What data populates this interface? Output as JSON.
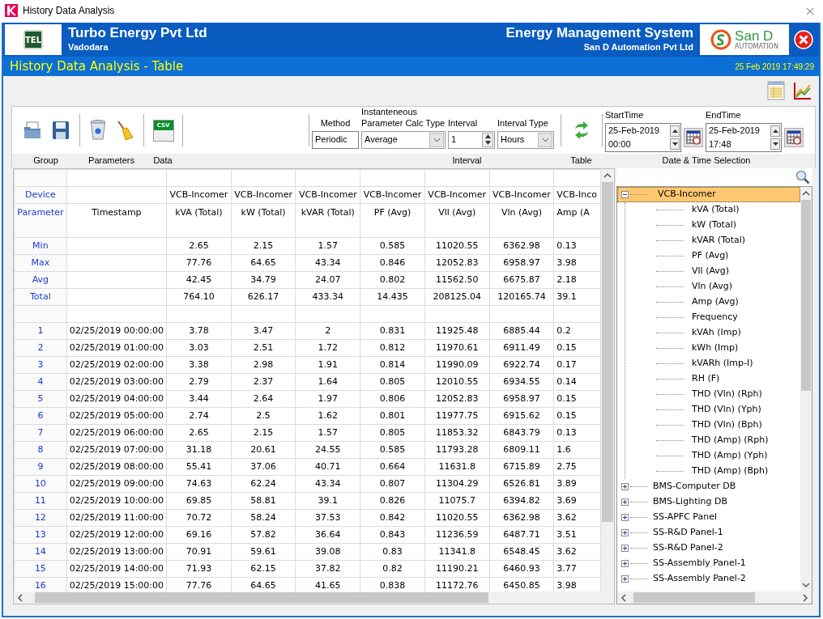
{
  "window": {
    "title": "History Data Analysis"
  },
  "header": {
    "logo_text": "TEL",
    "company": "Turbo Energy Pvt Ltd",
    "city": "Vadodara",
    "system": "Energy Management System",
    "vendor": "San D Automation Pvt Ltd",
    "vendor_logo": {
      "name": "San D",
      "tagline": "AUTOMATION"
    },
    "subtitle": "History Data Analysis - Table",
    "datetime": "25 Feb 2019 17:49:29"
  },
  "toolbar": {
    "group_label": "Group",
    "parameters_label": "Parameters",
    "data_label": "Data",
    "csv_text": "CSV",
    "interval_label": "Interval",
    "table_label": "Table",
    "datetime_label": "Date & Time Selection",
    "method": {
      "label": "Method",
      "value": "Periodic"
    },
    "calc_type": {
      "label_lines": [
        "Instanteneous",
        "Parameter Calc Type"
      ],
      "value": "Average"
    },
    "interval": {
      "label": "Interval",
      "value": "1"
    },
    "interval_type": {
      "label": "Interval Type",
      "value": "Hours"
    },
    "start": {
      "label": "StartTime",
      "date": "25-Feb-2019",
      "time": "00:00"
    },
    "end": {
      "label": "EndTime",
      "date": "25-Feb-2019",
      "time": "17:48"
    }
  },
  "table": {
    "device_label": "Device",
    "parameter_label": "Parameter",
    "timestamp_label": "Timestamp",
    "columns": [
      {
        "device": "VCB-Incomer",
        "parameter": "kVA (Total)"
      },
      {
        "device": "VCB-Incomer",
        "parameter": "kW (Total)"
      },
      {
        "device": "VCB-Incomer",
        "parameter": "kVAR (Total)"
      },
      {
        "device": "VCB-Incomer",
        "parameter": "PF (Avg)"
      },
      {
        "device": "VCB-Incomer",
        "parameter": "Vll (Avg)"
      },
      {
        "device": "VCB-Incomer",
        "parameter": "Vln (Avg)"
      },
      {
        "device": "VCB-Inco",
        "parameter": "Amp (A"
      }
    ],
    "summary": [
      {
        "label": "Min",
        "values": [
          "2.65",
          "2.15",
          "1.57",
          "0.585",
          "11020.55",
          "6362.98",
          "0.13"
        ]
      },
      {
        "label": "Max",
        "values": [
          "77.76",
          "64.65",
          "43.34",
          "0.846",
          "12052.83",
          "6958.97",
          "3.98"
        ]
      },
      {
        "label": "Avg",
        "values": [
          "42.45",
          "34.79",
          "24.07",
          "0.802",
          "11562.50",
          "6675.87",
          "2.18"
        ]
      },
      {
        "label": "Total",
        "values": [
          "764.10",
          "626.17",
          "433.34",
          "14.435",
          "208125.04",
          "120165.74",
          "39.1"
        ]
      }
    ],
    "rows": [
      {
        "index": "1",
        "timestamp": "02/25/2019 00:00:00",
        "values": [
          "3.78",
          "3.47",
          "2",
          "0.831",
          "11925.48",
          "6885.44",
          "0.2"
        ]
      },
      {
        "index": "2",
        "timestamp": "02/25/2019 01:00:00",
        "values": [
          "3.03",
          "2.51",
          "1.72",
          "0.812",
          "11970.61",
          "6911.49",
          "0.15"
        ]
      },
      {
        "index": "3",
        "timestamp": "02/25/2019 02:00:00",
        "values": [
          "3.38",
          "2.98",
          "1.91",
          "0.814",
          "11990.09",
          "6922.74",
          "0.17"
        ]
      },
      {
        "index": "4",
        "timestamp": "02/25/2019 03:00:00",
        "values": [
          "2.79",
          "2.37",
          "1.64",
          "0.805",
          "12010.55",
          "6934.55",
          "0.14"
        ]
      },
      {
        "index": "5",
        "timestamp": "02/25/2019 04:00:00",
        "values": [
          "3.44",
          "2.64",
          "1.97",
          "0.806",
          "12052.83",
          "6958.97",
          "0.15"
        ]
      },
      {
        "index": "6",
        "timestamp": "02/25/2019 05:00:00",
        "values": [
          "2.74",
          "2.5",
          "1.62",
          "0.801",
          "11977.75",
          "6915.62",
          "0.15"
        ]
      },
      {
        "index": "7",
        "timestamp": "02/25/2019 06:00:00",
        "values": [
          "2.65",
          "2.15",
          "1.57",
          "0.805",
          "11853.32",
          "6843.79",
          "0.13"
        ]
      },
      {
        "index": "8",
        "timestamp": "02/25/2019 07:00:00",
        "values": [
          "31.18",
          "20.61",
          "24.55",
          "0.585",
          "11793.28",
          "6809.11",
          "1.6"
        ]
      },
      {
        "index": "9",
        "timestamp": "02/25/2019 08:00:00",
        "values": [
          "55.41",
          "37.06",
          "40.71",
          "0.664",
          "11631.8",
          "6715.89",
          "2.75"
        ]
      },
      {
        "index": "10",
        "timestamp": "02/25/2019 09:00:00",
        "values": [
          "74.63",
          "62.24",
          "43.34",
          "0.807",
          "11304.29",
          "6526.81",
          "3.89"
        ]
      },
      {
        "index": "11",
        "timestamp": "02/25/2019 10:00:00",
        "values": [
          "69.85",
          "58.81",
          "39.1",
          "0.826",
          "11075.7",
          "6394.82",
          "3.69"
        ]
      },
      {
        "index": "12",
        "timestamp": "02/25/2019 11:00:00",
        "values": [
          "70.72",
          "58.24",
          "37.53",
          "0.842",
          "11020.55",
          "6362.98",
          "3.62"
        ]
      },
      {
        "index": "13",
        "timestamp": "02/25/2019 12:00:00",
        "values": [
          "69.16",
          "57.82",
          "36.64",
          "0.843",
          "11236.59",
          "6487.71",
          "3.51"
        ]
      },
      {
        "index": "14",
        "timestamp": "02/25/2019 13:00:00",
        "values": [
          "70.91",
          "59.61",
          "39.08",
          "0.83",
          "11341.8",
          "6548.45",
          "3.62"
        ]
      },
      {
        "index": "15",
        "timestamp": "02/25/2019 14:00:00",
        "values": [
          "71.93",
          "62.15",
          "37.82",
          "0.82",
          "11190.21",
          "6460.93",
          "3.77"
        ]
      },
      {
        "index": "16",
        "timestamp": "02/25/2019 15:00:00",
        "values": [
          "77.76",
          "64.65",
          "41.65",
          "0.838",
          "11172.76",
          "6450.85",
          "3.98"
        ]
      }
    ]
  },
  "tree": {
    "items": [
      {
        "label": "VCB-Incomer",
        "expanded": true,
        "selected": true,
        "children": [
          {
            "label": "kVA (Total)"
          },
          {
            "label": "kW (Total)"
          },
          {
            "label": "kVAR (Total)"
          },
          {
            "label": "PF (Avg)"
          },
          {
            "label": "Vll (Avg)"
          },
          {
            "label": "Vln (Avg)"
          },
          {
            "label": "Amp (Avg)"
          },
          {
            "label": "Frequency"
          },
          {
            "label": "kVAh (Imp)"
          },
          {
            "label": "kWh (Imp)"
          },
          {
            "label": "kVARh (Imp-I)"
          },
          {
            "label": "RH (F)"
          },
          {
            "label": "THD (Vln) (Rph)"
          },
          {
            "label": "THD (Vln) (Yph)"
          },
          {
            "label": "THD (Vln) (Bph)"
          },
          {
            "label": "THD (Amp) (Rph)"
          },
          {
            "label": "THD (Amp) (Yph)"
          },
          {
            "label": "THD (Amp) (Bph)"
          }
        ]
      },
      {
        "label": "BMS-Computer DB",
        "expanded": false,
        "selected": false
      },
      {
        "label": "BMS-Lighting DB",
        "expanded": false,
        "selected": false
      },
      {
        "label": "SS-APFC Panel",
        "expanded": false,
        "selected": false
      },
      {
        "label": "SS-R&D Panel-1",
        "expanded": false,
        "selected": false
      },
      {
        "label": "SS-R&D Panel-2",
        "expanded": false,
        "selected": false
      },
      {
        "label": "SS-Assembly Panel-1",
        "expanded": false,
        "selected": false
      },
      {
        "label": "SS-Assembly Panel-2",
        "expanded": false,
        "selected": false
      }
    ]
  }
}
